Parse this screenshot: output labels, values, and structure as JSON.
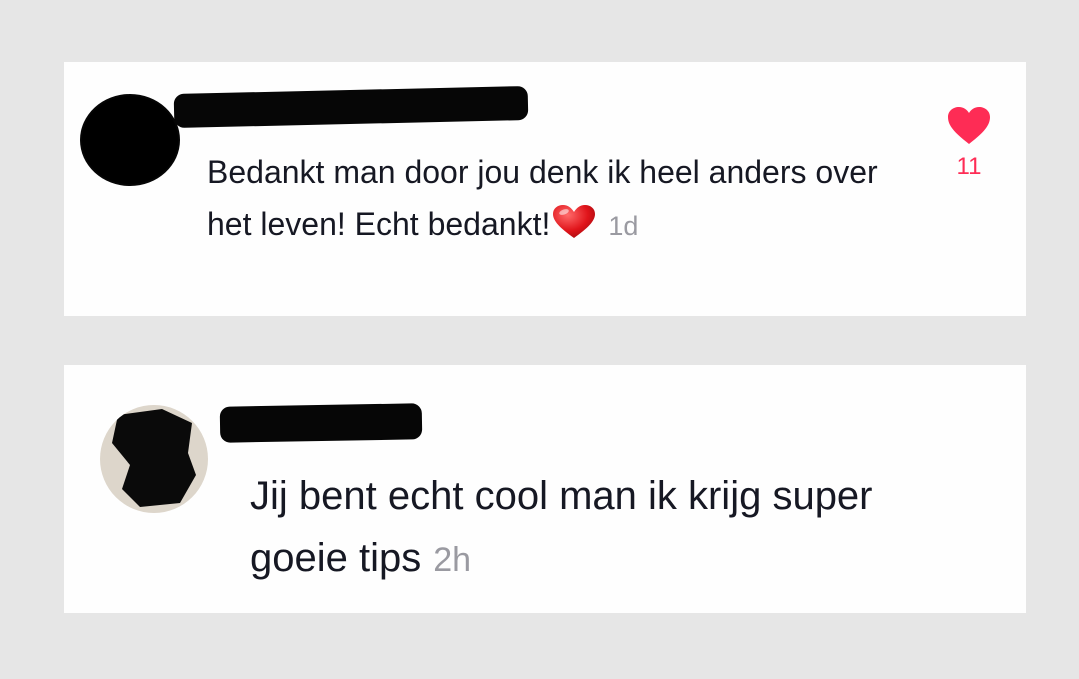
{
  "comments": [
    {
      "text": "Bedankt man door jou denk ik heel anders over het leven! Echt bedankt!",
      "emoji": "red-heart",
      "time": "1d",
      "likes": "11",
      "like_color": "#fe2c55"
    },
    {
      "text": "Jij bent echt cool man ik krijg super goeie tips",
      "time": "2h"
    }
  ]
}
